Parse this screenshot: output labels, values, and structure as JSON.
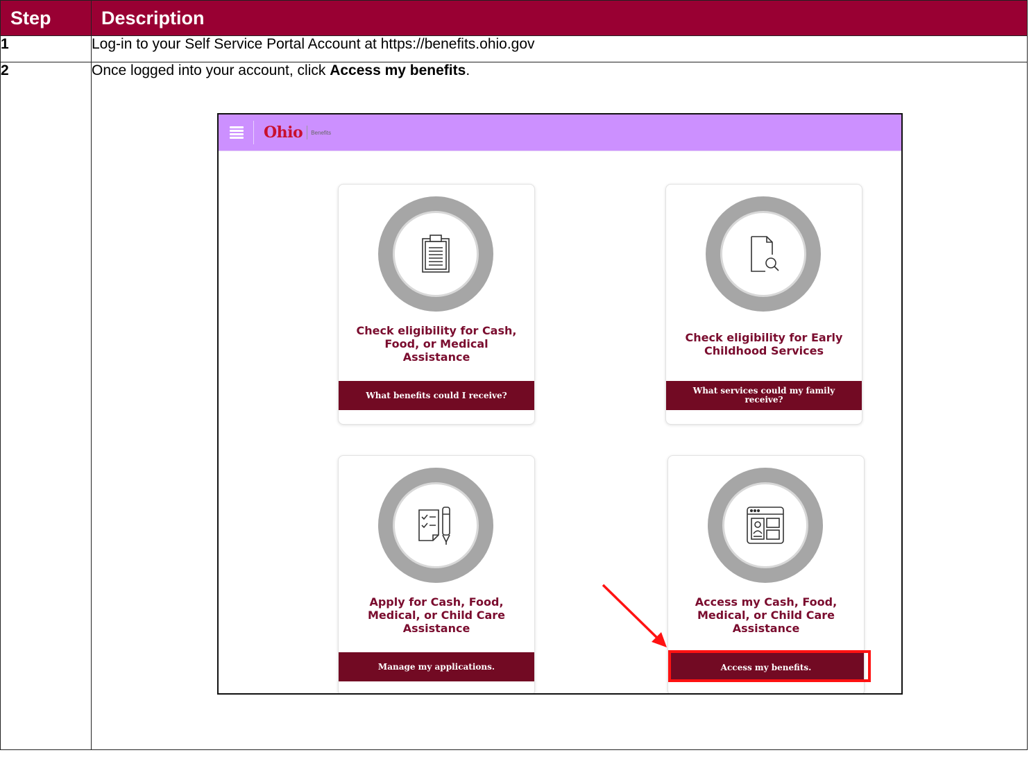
{
  "table": {
    "header": {
      "step": "Step",
      "description": "Description"
    },
    "rows": [
      {
        "step": "1",
        "text": "Log-in to your Self Service Portal Account at https://benefits.ohio.gov"
      },
      {
        "step": "2",
        "text_before": "Once logged into your account, click ",
        "text_bold": "Access my benefits",
        "text_after": "."
      }
    ]
  },
  "portal": {
    "logo": "Ohio",
    "logo_sub": "Benefits",
    "cards": [
      {
        "title": "Check eligibility for Cash,\nFood, or Medical\nAssistance",
        "button": "What benefits could I receive?",
        "icon": "clipboard-icon"
      },
      {
        "title": "Check eligibility for Early\nChildhood Services",
        "button": "What services could my family receive?",
        "icon": "document-search-icon"
      },
      {
        "title": "Apply for Cash, Food,\nMedical, or Child Care\nAssistance",
        "button": "Manage my applications.",
        "icon": "checklist-pen-icon"
      },
      {
        "title": "Access my Cash, Food,\nMedical, or Child Care\nAssistance",
        "button": "Access my benefits.",
        "icon": "browser-profile-icon"
      }
    ]
  },
  "annotation": {
    "highlight_color": "#ff1212",
    "target": "Access my benefits."
  },
  "colors": {
    "header_bg": "#990033",
    "portal_bar": "#cc90ff",
    "button_bg": "#720a23",
    "title_text": "#7a0c2e"
  }
}
